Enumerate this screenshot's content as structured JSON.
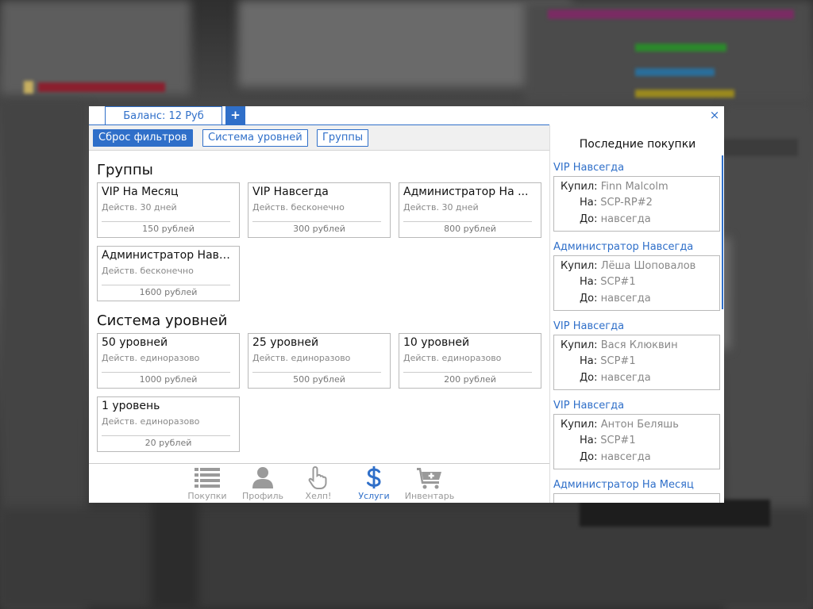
{
  "tabs": {
    "balance_label": "Баланс: 12 Руб",
    "add_label": "+"
  },
  "close_label": "×",
  "filters": {
    "reset": "Сброс фильтров",
    "levels": "Система уровней",
    "groups": "Группы"
  },
  "sections": [
    {
      "title": "Группы",
      "items": [
        {
          "name": "VIP На Месяц",
          "desc": "Действ. 30 дней",
          "price": "150 рублей"
        },
        {
          "name": "VIP Навсегда",
          "desc": "Действ. бесконечно",
          "price": "300 рублей"
        },
        {
          "name": "Администратор На ...",
          "desc": "Действ. 30 дней",
          "price": "800 рублей"
        },
        {
          "name": "Администратор Навс...",
          "desc": "Действ. бесконечно",
          "price": "1600 рублей"
        }
      ]
    },
    {
      "title": "Система уровней",
      "items": [
        {
          "name": "50 уровней",
          "desc": "Действ. единоразово",
          "price": "1000 рублей"
        },
        {
          "name": "25 уровней",
          "desc": "Действ. единоразово",
          "price": "500 рублей"
        },
        {
          "name": "10 уровней",
          "desc": "Действ. единоразово",
          "price": "200 рублей"
        },
        {
          "name": "1 уровень",
          "desc": "Действ. единоразово",
          "price": "20 рублей"
        }
      ]
    }
  ],
  "nav": [
    {
      "label": "Покупки",
      "icon": "list-icon"
    },
    {
      "label": "Профиль",
      "icon": "user-icon"
    },
    {
      "label": "Хелп!",
      "icon": "hand-pointer-icon"
    },
    {
      "label": "Услуги",
      "icon": "dollar-icon",
      "active": true
    },
    {
      "label": "Инвентарь",
      "icon": "cart-plus-icon"
    }
  ],
  "recent": {
    "title": "Последние покупки",
    "keys": {
      "buyer": "Купил:",
      "target": "На:",
      "until": "До:"
    },
    "items": [
      {
        "title": "VIP Навсегда",
        "buyer": "Finn Malcolm",
        "target": "SCP-RP#2",
        "until": "навсегда"
      },
      {
        "title": "Администратор Навсегда",
        "buyer": "Лёша Шоповалов",
        "target": "SCP#1",
        "until": "навсегда"
      },
      {
        "title": "VIP Навсегда",
        "buyer": "Вася Клюквин",
        "target": "SCP#1",
        "until": "навсегда"
      },
      {
        "title": "VIP Навсегда",
        "buyer": "Антон Беляшь",
        "target": "SCP#1",
        "until": "навсегда"
      },
      {
        "title": "Администратор На Месяц"
      }
    ]
  },
  "colors": {
    "accent": "#2f6fc9"
  }
}
